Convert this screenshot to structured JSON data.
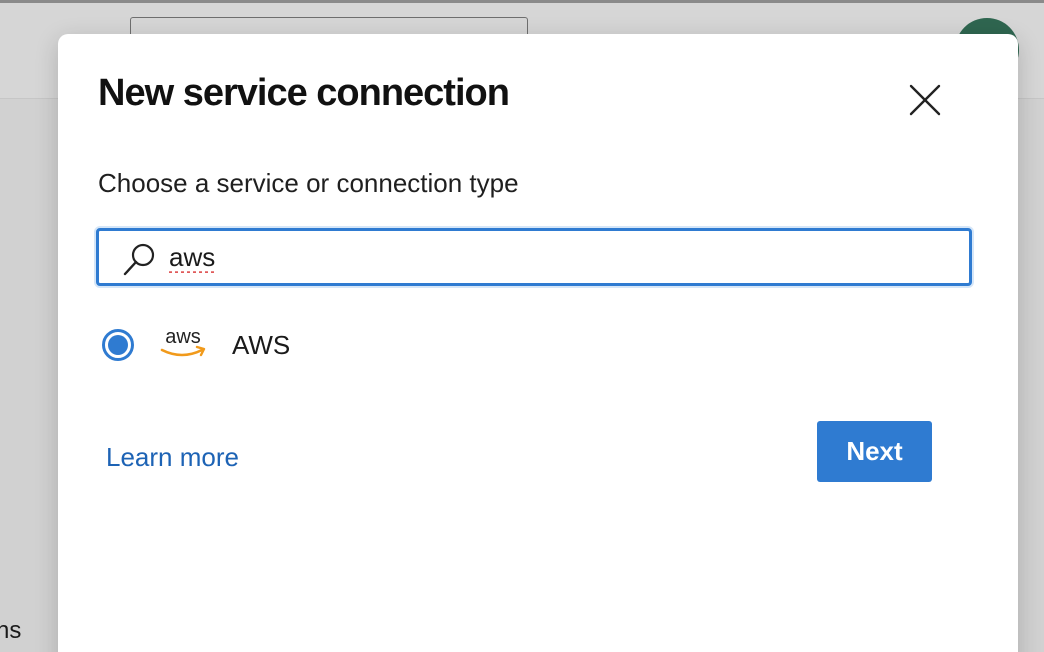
{
  "background": {
    "fragment_text": "ns"
  },
  "dialog": {
    "title": "New service connection",
    "subtitle": "Choose a service or connection type",
    "search": {
      "value": "aws",
      "placeholder": ""
    },
    "options": [
      {
        "label": "AWS",
        "logo_text": "aws",
        "selected": true
      }
    ],
    "learn_more_label": "Learn more",
    "next_label": "Next"
  },
  "icons": {
    "close": "close-icon",
    "search": "search-icon",
    "aws_logo": "aws-logo-icon"
  },
  "colors": {
    "accent": "#2f7bd1",
    "link": "#1d63b5",
    "aws_smile": "#f19a1b",
    "avatar": "#2f6650"
  }
}
